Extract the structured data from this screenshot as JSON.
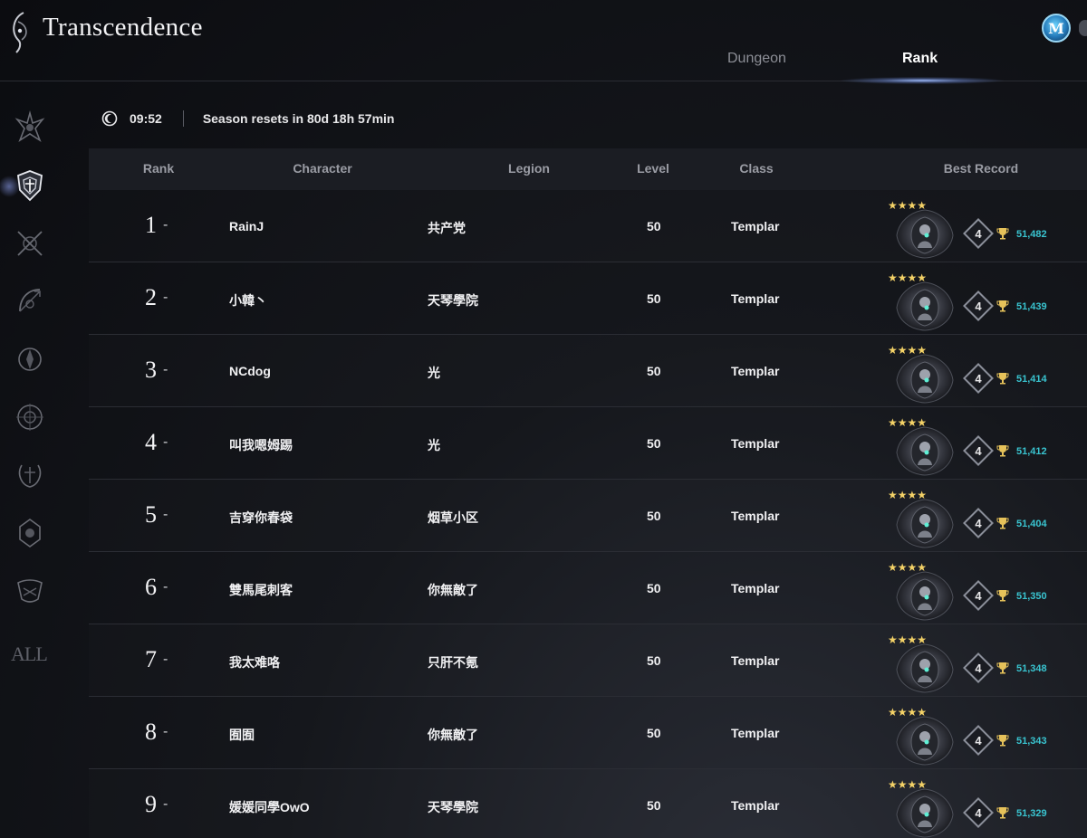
{
  "app": {
    "title": "Transcendence"
  },
  "tabs": [
    {
      "label": "Dungeon",
      "active": false
    },
    {
      "label": "Rank",
      "active": true
    }
  ],
  "season": {
    "time": "09:52",
    "reset_text": "Season resets in 80d 18h 57min"
  },
  "sidebar": {
    "icons": [
      "gladiator-icon",
      "templar-icon",
      "assassin-icon",
      "ranger-icon",
      "sorcerer-icon",
      "spiritmaster-icon",
      "cleric-icon",
      "chanter-icon",
      "painter-icon"
    ],
    "all_label": "ALL",
    "active_index": 1
  },
  "table": {
    "headers": {
      "rank": "Rank",
      "character": "Character",
      "legion": "Legion",
      "level": "Level",
      "class": "Class",
      "record": "Best Record"
    },
    "rows": [
      {
        "rank": "1",
        "dash": "-",
        "character": "RainJ",
        "legion": "共产党",
        "level": "50",
        "class": "Templar",
        "stars": "★★★★",
        "tier": "4",
        "score": "51,482"
      },
      {
        "rank": "2",
        "dash": "-",
        "character": "小韓丶",
        "legion": "天琴學院",
        "level": "50",
        "class": "Templar",
        "stars": "★★★★",
        "tier": "4",
        "score": "51,439"
      },
      {
        "rank": "3",
        "dash": "-",
        "character": "NCdog",
        "legion": "光",
        "level": "50",
        "class": "Templar",
        "stars": "★★★★",
        "tier": "4",
        "score": "51,414"
      },
      {
        "rank": "4",
        "dash": "-",
        "character": "叫我嗯姆踢",
        "legion": "光",
        "level": "50",
        "class": "Templar",
        "stars": "★★★★",
        "tier": "4",
        "score": "51,412"
      },
      {
        "rank": "5",
        "dash": "-",
        "character": "吉穿你春袋",
        "legion": "烟草小区",
        "level": "50",
        "class": "Templar",
        "stars": "★★★★",
        "tier": "4",
        "score": "51,404"
      },
      {
        "rank": "6",
        "dash": "-",
        "character": "雙馬尾刺客",
        "legion": "你無敵了",
        "level": "50",
        "class": "Templar",
        "stars": "★★★★",
        "tier": "4",
        "score": "51,350"
      },
      {
        "rank": "7",
        "dash": "-",
        "character": "我太难咯",
        "legion": "只肝不氪",
        "level": "50",
        "class": "Templar",
        "stars": "★★★★",
        "tier": "4",
        "score": "51,348"
      },
      {
        "rank": "8",
        "dash": "-",
        "character": "囿囿",
        "legion": "你無敵了",
        "level": "50",
        "class": "Templar",
        "stars": "★★★★",
        "tier": "4",
        "score": "51,343"
      },
      {
        "rank": "9",
        "dash": "-",
        "character": "媛媛同學OwO",
        "legion": "天琴學院",
        "level": "50",
        "class": "Templar",
        "stars": "★★★★",
        "tier": "4",
        "score": "51,329"
      }
    ]
  },
  "colors": {
    "score": "#39c4d0",
    "stars": "#f4d267",
    "accent_glow": "#a0beff"
  }
}
